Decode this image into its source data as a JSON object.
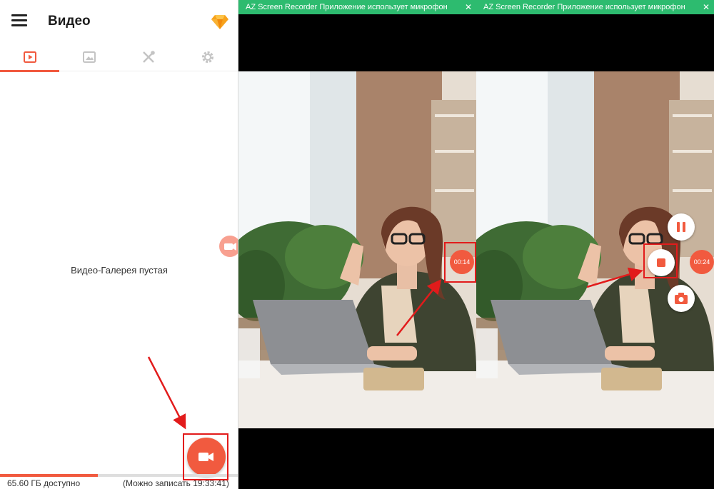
{
  "app": {
    "title": "Видео",
    "tabs": [
      {
        "icon": "video-icon",
        "active": true
      },
      {
        "icon": "image-icon",
        "active": false
      },
      {
        "icon": "tools-icon",
        "active": false
      },
      {
        "icon": "settings-icon",
        "active": false
      }
    ],
    "empty_message": "Видео-Галерея пустая",
    "storage": {
      "available": "65.60 ГБ доступно",
      "remaining": "(Можно записать 19:33:41)",
      "used_fraction": 0.41
    },
    "colors": {
      "accent": "#f15a3f",
      "annotation": "#e21b1b"
    }
  },
  "notification": {
    "text": "AZ Screen Recorder Приложение использует микрофон"
  },
  "recording": {
    "timer_first": "00:14",
    "timer_second": "00:24"
  }
}
